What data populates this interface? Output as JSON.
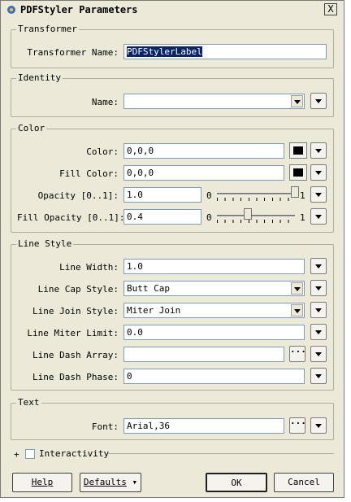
{
  "window": {
    "title": "PDFStyler Parameters",
    "close_label": "X"
  },
  "transformer": {
    "legend": "Transformer",
    "name_label": "Transformer Name:",
    "name_value": "PDFStylerLabel"
  },
  "identity": {
    "legend": "Identity",
    "name_label": "Name:",
    "name_value": ""
  },
  "color": {
    "legend": "Color",
    "color_label": "Color:",
    "color_value": "0,0,0",
    "fill_label": "Fill Color:",
    "fill_value": "0,0,0",
    "opacity_label": "Opacity [0..1]:",
    "opacity_value": "1.0",
    "fill_opacity_label": "Fill Opacity [0..1]:",
    "fill_opacity_value": "0.4",
    "slider_min": "0",
    "slider_max": "1",
    "opacity_level": 1.0,
    "fill_opacity_level": 0.4
  },
  "line_style": {
    "legend": "Line Style",
    "width_label": "Line Width:",
    "width_value": "1.0",
    "cap_label": "Line Cap Style:",
    "cap_value": "Butt Cap",
    "join_label": "Line Join Style:",
    "join_value": "Miter Join",
    "miter_label": "Line Miter Limit:",
    "miter_value": "0.0",
    "dash_array_label": "Line Dash Array:",
    "dash_array_value": "",
    "dash_phase_label": "Line Dash Phase:",
    "dash_phase_value": "0"
  },
  "text": {
    "legend": "Text",
    "font_label": "Font:",
    "font_value": "Arial,36"
  },
  "interactivity": {
    "expander": "+",
    "label": "Interactivity"
  },
  "buttons": {
    "help": "Help",
    "defaults": "Defaults",
    "ok": "OK",
    "cancel": "Cancel"
  },
  "icons": {
    "title": "app-icon",
    "menu": "chevron-down-icon",
    "more": "ellipsis-icon"
  }
}
